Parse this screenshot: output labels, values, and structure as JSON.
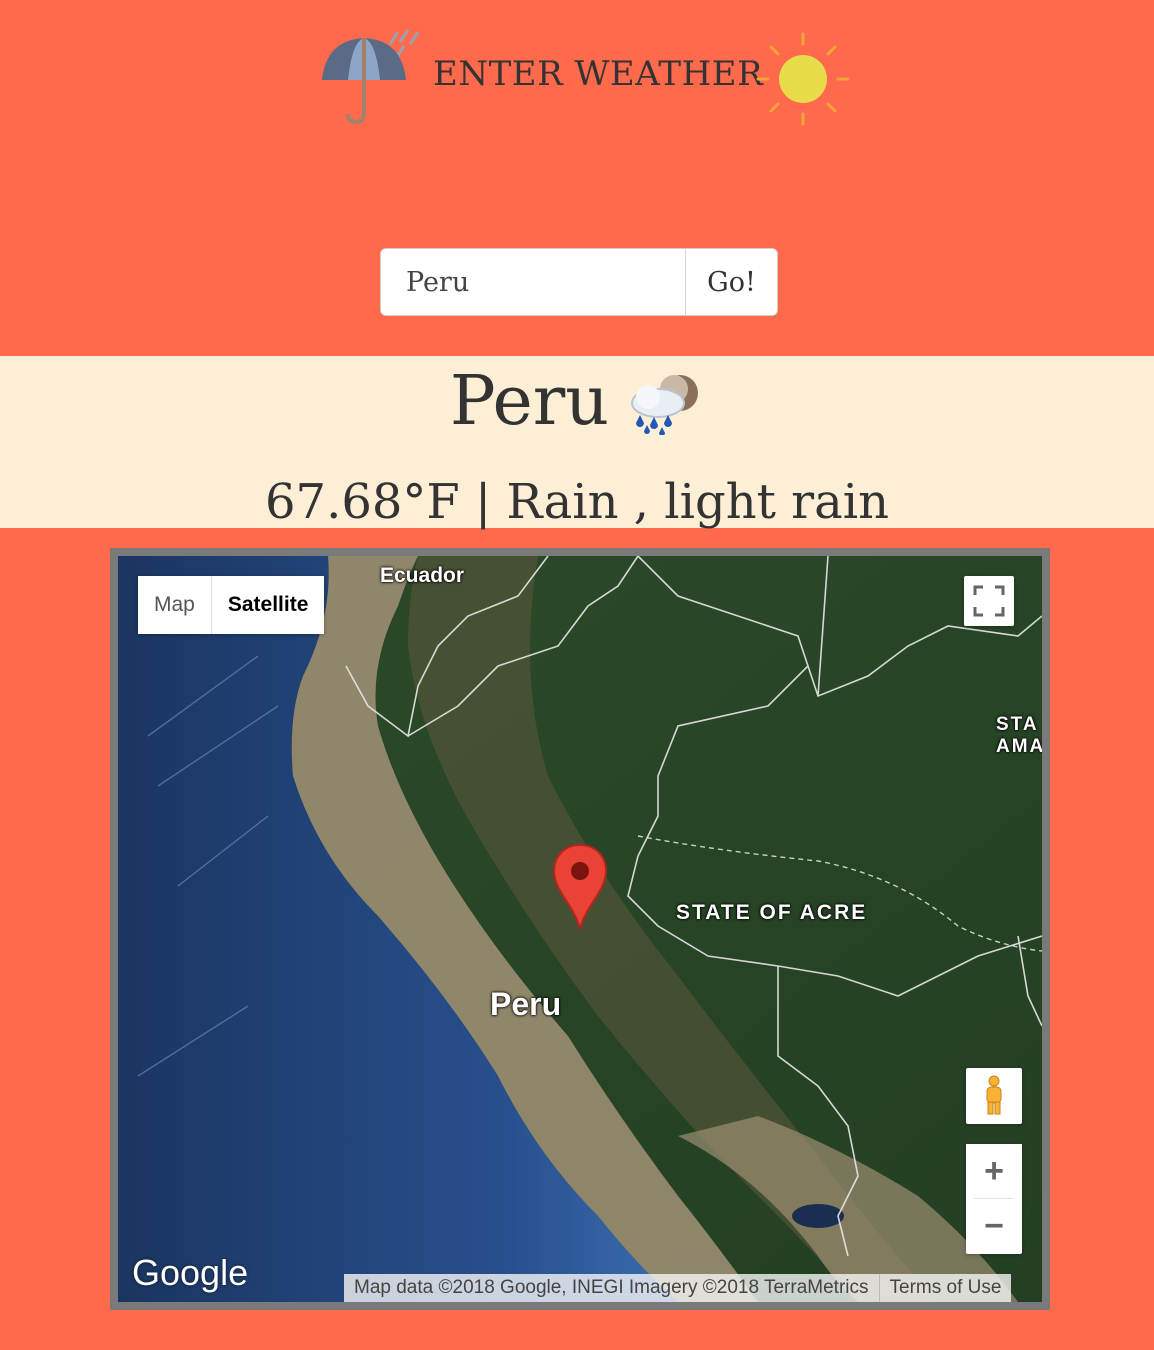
{
  "header": {
    "title": "ENTER WEATHER",
    "umbrella_icon": "umbrella-rain-icon",
    "sun_icon": "sun-icon"
  },
  "search": {
    "value": "Peru",
    "button_label": "Go!"
  },
  "result": {
    "city": "Peru",
    "weather_icon": "rain-cloud-icon",
    "summary": "67.68°F | Rain , light rain"
  },
  "map": {
    "type_map_label": "Map",
    "type_satellite_label": "Satellite",
    "selected_type": "Satellite",
    "labels": {
      "ecuador": "Ecuador",
      "acre": "STATE OF ACRE",
      "peru": "Peru",
      "sta_line1": "STA",
      "sta_line2": "AMA"
    },
    "zoom_in_label": "+",
    "zoom_out_label": "−",
    "google_logo": "Google",
    "attribution": "Map data ©2018 Google, INEGI Imagery ©2018 TerraMetrics",
    "terms": "Terms of Use"
  },
  "colors": {
    "background": "#ff6a4d",
    "result_panel": "#fdefd5",
    "marker": "#ea4335"
  }
}
